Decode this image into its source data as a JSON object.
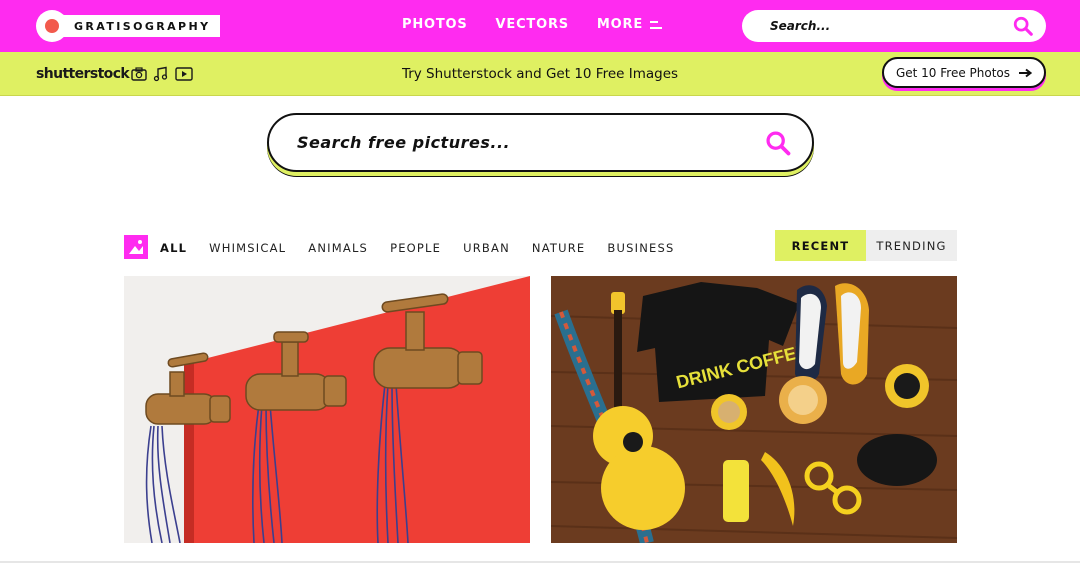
{
  "brand": {
    "logo_text": "GRATISOGRAPHY",
    "accent": "#ff2bf0",
    "lime": "#dff062",
    "logo_dot": "#f25a4d"
  },
  "nav": {
    "items": [
      "PHOTOS",
      "VECTORS",
      "MORE"
    ]
  },
  "header_search": {
    "placeholder": "Search..."
  },
  "promo": {
    "logo_text": "shutterstock",
    "media_icons": [
      "camera-icon",
      "music-icon",
      "video-icon"
    ],
    "text": "Try Shutterstock and Get 10 Free Images",
    "button_label": "Get 10 Free Photos",
    "button_icon": "arrow-right-icon"
  },
  "main_search": {
    "placeholder": "Search free pictures..."
  },
  "categories": {
    "icon": "image-icon",
    "items": [
      "ALL",
      "WHIMSICAL",
      "ANIMALS",
      "PEOPLE",
      "URBAN",
      "NATURE",
      "BUSINESS"
    ],
    "active": "ALL"
  },
  "sort": {
    "options": [
      "RECENT",
      "TRENDING"
    ],
    "active": "RECENT"
  },
  "photos": [
    {
      "subject": "faucets-with-wires",
      "label_on_image": ""
    },
    {
      "subject": "flat-lay-ukulele-shirt-banana",
      "label_on_image": "DRINK COFFEE"
    }
  ]
}
